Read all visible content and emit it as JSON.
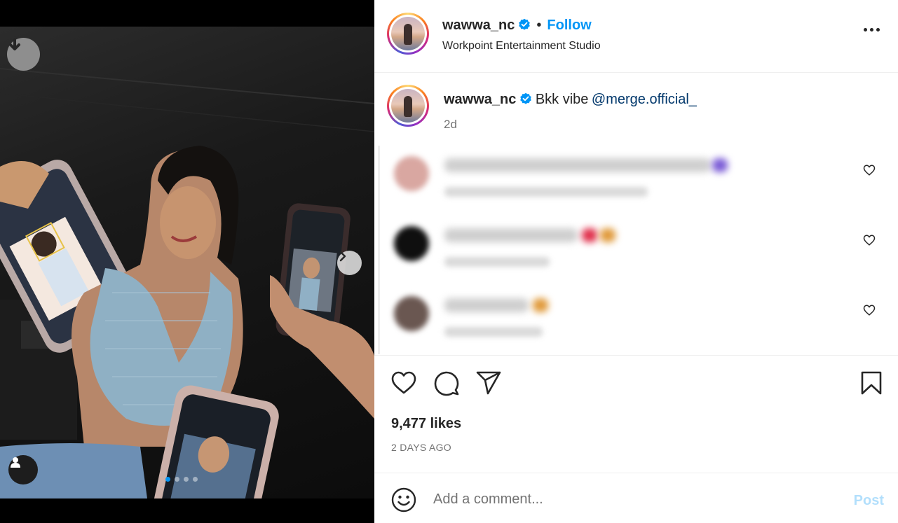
{
  "post": {
    "username": "wawwa_nc",
    "verified": true,
    "follow_label": "Follow",
    "separator": "•",
    "location": "Workpoint Entertainment Studio",
    "caption": {
      "username": "wawwa_nc",
      "text": "Bkk vibe",
      "mention": "@merge.official_",
      "time": "2d"
    },
    "likes": "9,477 likes",
    "date": "2 DAYS AGO"
  },
  "media": {
    "carousel_index": 1,
    "carousel_count": 4
  },
  "comments_blurred": true,
  "comments": [
    {
      "avatar_color": "#d9a7a1",
      "text_color": "#c9c9c9",
      "emoji_color": "#7b5cd6"
    },
    {
      "avatar_color": "#0f0f0f",
      "text_color": "#c9c9c9",
      "emoji_color": "#e0304b"
    },
    {
      "avatar_color": "#6a5751",
      "text_color": "#c9c9c9",
      "emoji_color": "#e09a3b"
    }
  ],
  "composer": {
    "placeholder": "Add a comment...",
    "post_label": "Post"
  },
  "colors": {
    "accent": "#0095f6",
    "post_disabled": "#b2dffc",
    "mention": "#00376b",
    "muted": "#737373"
  },
  "icons": [
    "download-icon",
    "chevron-right-icon",
    "user-tag-icon",
    "verified-badge-icon",
    "more-options-icon",
    "heart-icon",
    "comment-icon",
    "share-icon",
    "bookmark-icon",
    "emoji-icon"
  ]
}
